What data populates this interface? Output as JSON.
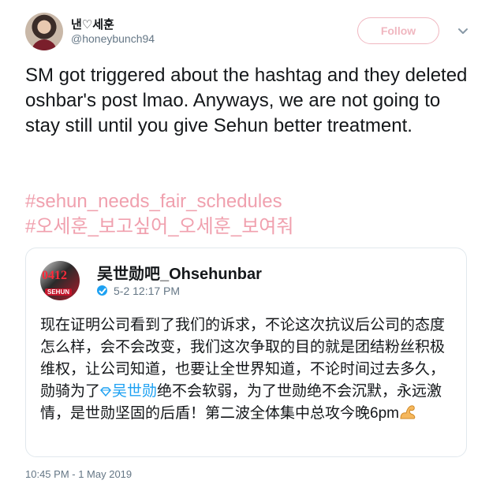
{
  "user": {
    "display_name": "낸♡세훈",
    "handle": "@honeybunch94"
  },
  "follow_button": {
    "label": "Follow"
  },
  "tweet": {
    "text": "SM got triggered about the hashtag and they deleted oshbar's post lmao. Anyways, we are not going to stay still until you give Sehun better treatment.",
    "hashtags": [
      "#sehun_needs_fair_schedules",
      "#오세훈_보고싶어_오세훈_보여줘"
    ]
  },
  "quoted_tweet": {
    "name": "吴世勋吧_Ohsehunbar",
    "time": "5-2 12:17 PM",
    "avatar_text": "0412",
    "avatar_tag": "SEHUN",
    "body_before": "现在证明公司看到了我们的诉求，不论这次抗议后公司的态度怎么样，会不会改变，我们这次争取的目的就是团结粉丝积极维权，让公司知道，也要让全世界知道，不论时间过去多久，勋骑为了",
    "mention": "吴世勋",
    "body_after": "绝不会软弱，为了世勋绝不会沉默，永远激情，是世勋坚固的后盾！第二波全体集中总攻今晚6pm"
  },
  "timestamp": "10:45 PM - 1 May 2019",
  "colors": {
    "accent_pink": "#f0a0ae",
    "link_blue": "#1da1f2",
    "secondary_text": "#657786"
  }
}
